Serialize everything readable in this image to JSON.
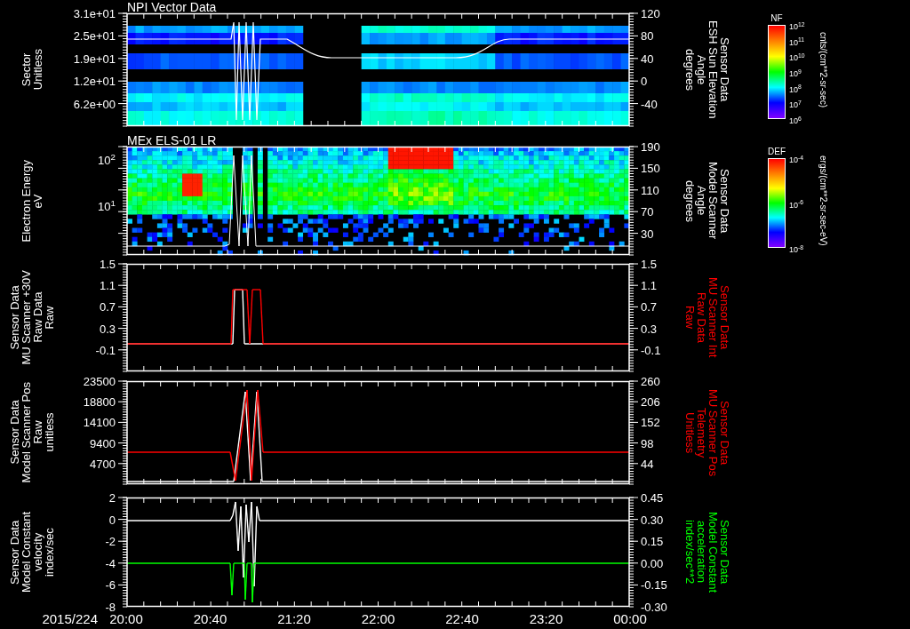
{
  "panels": [
    {
      "kind": "sector",
      "title": "NPI Vector Data",
      "left_axis": {
        "label": [
          "Sector",
          "Unitless"
        ],
        "ticks": [
          "3.1e+01",
          "2.5e+01",
          "1.9e+01",
          "1.2e+01",
          "6.2e+00"
        ]
      },
      "right_axis": {
        "label": [
          "Sensor Data",
          "ESH Sun Elevation",
          "Angle",
          "degrees"
        ],
        "color": "#ffffff",
        "ticks": [
          "120",
          "80",
          "40",
          "0",
          "-40"
        ]
      },
      "colorbar": {
        "name": "NF",
        "units": "cnts/(cm**2-sr-sec)",
        "ticks": [
          "10$^{12}$",
          "10$^{11}$",
          "10$^{10}$",
          "10$^{9}$",
          "10$^{8}$",
          "10$^{7}$",
          "10$^{6}$"
        ]
      }
    },
    {
      "kind": "energy",
      "title": "MEx ELS-01 LR",
      "left_axis": {
        "label": [
          "Electron Energy",
          "eV"
        ],
        "ticks": [
          "10$^{2}$",
          "10$^{1}$"
        ]
      },
      "right_axis": {
        "label": [
          "Sensor Data",
          "Model Scanner",
          "Angle",
          "degrees"
        ],
        "color": "#ffffff",
        "ticks": [
          "190",
          "150",
          "110",
          "70",
          "30"
        ]
      },
      "colorbar": {
        "name": "DEF",
        "units": "ergs/(cm**2-sr-sec-eV)",
        "ticks": [
          "10$^{-4}$",
          "10$^{-6}$",
          "10$^{-8}$"
        ]
      }
    },
    {
      "kind": "pulse",
      "left_axis": {
        "label": [
          "Sensor Data",
          "MU Scanner +30V",
          "Raw Data",
          "Raw"
        ],
        "ticks": [
          "1.5",
          "1.1",
          "0.7",
          "0.3",
          "-0.1"
        ]
      },
      "right_axis": {
        "label": [
          "Sensor Data",
          "MU Scanner Int",
          "Raw Data",
          "Raw"
        ],
        "color": "#ff0000",
        "ticks": [
          "1.5",
          "1.1",
          "0.7",
          "0.3",
          "-0.1"
        ]
      }
    },
    {
      "kind": "ramp",
      "left_axis": {
        "label": [
          "Sensor Data",
          "Model Scanner Pos",
          "Raw",
          "unitless"
        ],
        "ticks": [
          "23500",
          "18800",
          "14100",
          "9400",
          "4700"
        ]
      },
      "right_axis": {
        "label": [
          "Sensor Data",
          "MU Scanner Pos",
          "Telemetry",
          "Unitless"
        ],
        "color": "#ff0000",
        "ticks": [
          "260",
          "206",
          "152",
          "98",
          "44"
        ]
      }
    },
    {
      "kind": "velocity",
      "left_axis": {
        "label": [
          "Sensor Data",
          "Model Constant",
          "velocity",
          "index/sec"
        ],
        "ticks": [
          "2",
          "0",
          "-2",
          "-4",
          "-6",
          "-8"
        ]
      },
      "right_axis": {
        "label": [
          "Sensor Data",
          "Model Constant",
          "acceleration",
          "index/sec**2"
        ],
        "color": "#00ff00",
        "ticks": [
          "0.45",
          "0.30",
          "0.15",
          "0.00",
          "-0.15",
          "-0.30"
        ]
      }
    }
  ],
  "date_label": "2015/224",
  "time_ticks": [
    "20:00",
    "20:40",
    "21:20",
    "22:00",
    "22:40",
    "23:20",
    "00:00"
  ]
}
